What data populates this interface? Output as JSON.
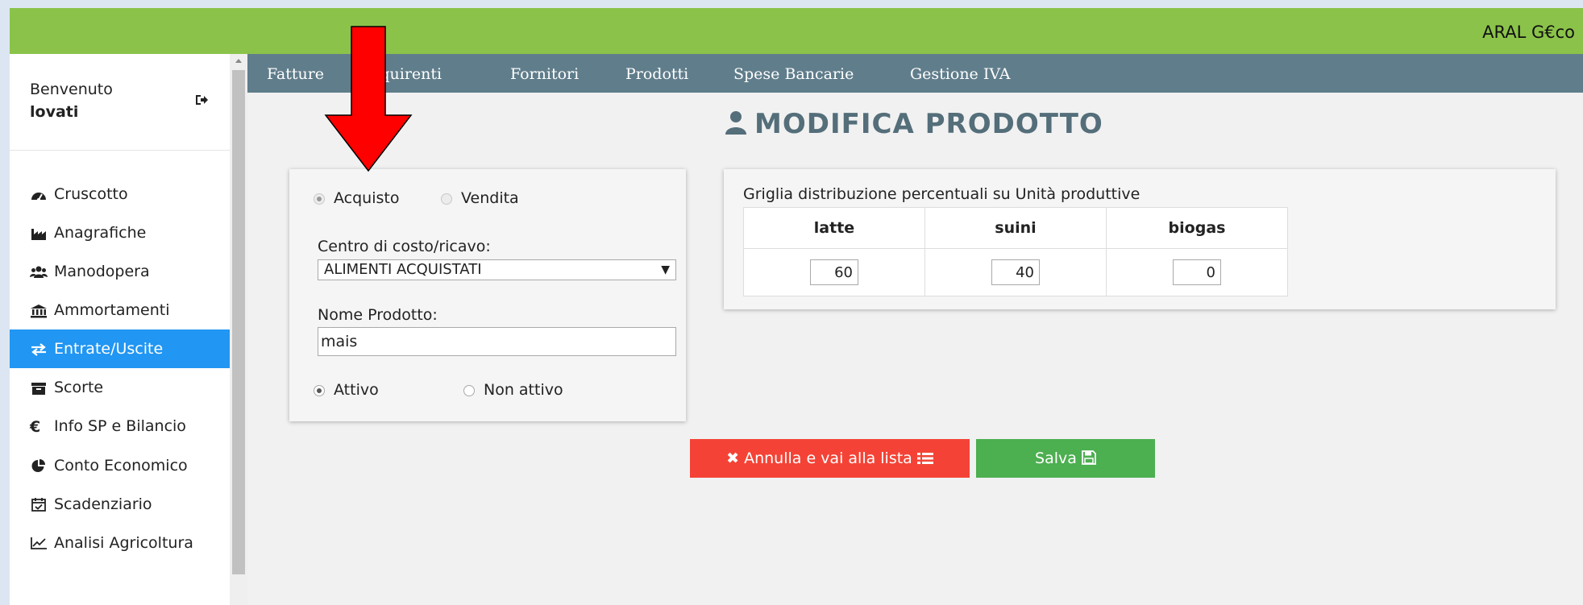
{
  "app": {
    "brand": "ARAL G€co"
  },
  "user": {
    "welcome": "Benvenuto",
    "name": "lovati"
  },
  "sidebar": {
    "items": [
      {
        "label": "Cruscotto",
        "icon": "dashboard-icon",
        "active": false
      },
      {
        "label": "Anagrafiche",
        "icon": "industry-icon",
        "active": false
      },
      {
        "label": "Manodopera",
        "icon": "users-icon",
        "active": false
      },
      {
        "label": "Ammortamenti",
        "icon": "bank-icon",
        "active": false
      },
      {
        "label": "Entrate/Uscite",
        "icon": "exchange-icon",
        "active": true
      },
      {
        "label": "Scorte",
        "icon": "archive-icon",
        "active": false
      },
      {
        "label": "Info SP e Bilancio",
        "icon": "euro-icon",
        "active": false
      },
      {
        "label": "Conto Economico",
        "icon": "pie-chart-icon",
        "active": false
      },
      {
        "label": "Scadenziario",
        "icon": "calendar-check-icon",
        "active": false
      },
      {
        "label": "Analisi Agricoltura",
        "icon": "line-chart-icon",
        "active": false
      }
    ]
  },
  "nav": {
    "items": [
      {
        "label": "Fatture"
      },
      {
        "label": "Acquirenti"
      },
      {
        "label": "Fornitori"
      },
      {
        "label": "Prodotti"
      },
      {
        "label": "Spese Bancarie"
      },
      {
        "label": "Gestione IVA"
      }
    ]
  },
  "page": {
    "title": "MODIFICA PRODOTTO",
    "title_icon": "user-icon"
  },
  "form": {
    "tipo": {
      "options": [
        "Acquisto",
        "Vendita"
      ],
      "selected": "Acquisto",
      "disabled": true
    },
    "centro_label": "Centro di costo/ricavo:",
    "centro_value": "ALIMENTI ACQUISTATI",
    "nome_label": "Nome Prodotto:",
    "nome_value": "mais",
    "stato": {
      "options": [
        "Attivo",
        "Non attivo"
      ],
      "selected": "Attivo"
    }
  },
  "grid": {
    "title": "Griglia distribuzione percentuali su Unità produttive",
    "columns": [
      "latte",
      "suini",
      "biogas"
    ],
    "values": [
      "60",
      "40",
      "0"
    ]
  },
  "buttons": {
    "cancel": "Annulla e vai alla lista",
    "save": "Salva"
  },
  "colors": {
    "topbar": "#8bc34a",
    "navbar": "#607d8b",
    "active_item": "#2196f3",
    "cancel_button": "#f44336",
    "save_button": "#4caf50",
    "title": "#546e7a",
    "annotation_arrow": "#ff0000"
  }
}
